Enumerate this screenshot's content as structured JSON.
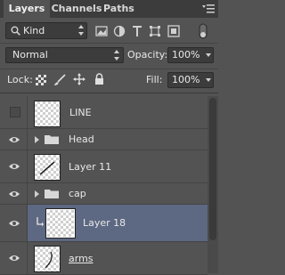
{
  "tabs": [
    {
      "label": "Layers",
      "active": true
    },
    {
      "label": "Channels",
      "active": false
    },
    {
      "label": "Paths",
      "active": false
    }
  ],
  "panel_menu_icon": "panel-menu-icon",
  "filter": {
    "kind_label": "Kind",
    "icons": [
      "pixel-filter-icon",
      "adjustment-filter-icon",
      "type-filter-icon",
      "shape-filter-icon",
      "smart-object-filter-icon",
      "filter-toggle-icon"
    ]
  },
  "blend": {
    "mode_label": "Normal",
    "opacity_label": "Opacity:",
    "opacity_value": "100%"
  },
  "lock": {
    "label": "Lock:",
    "icons": [
      "lock-transparent-icon",
      "lock-image-icon",
      "lock-position-icon",
      "lock-all-icon"
    ],
    "fill_label": "Fill:",
    "fill_value": "100%"
  },
  "layers": [
    {
      "name": "LINE",
      "type": "layer",
      "visible": false,
      "selected": false
    },
    {
      "name": "Head",
      "type": "group",
      "visible": true,
      "selected": false
    },
    {
      "name": "Layer 11",
      "type": "layer",
      "visible": true,
      "selected": false
    },
    {
      "name": "cap",
      "type": "group",
      "visible": true,
      "selected": false
    },
    {
      "name": "Layer 18",
      "type": "layer",
      "visible": true,
      "selected": true,
      "clipped": true
    },
    {
      "name": "arms",
      "type": "layer",
      "visible": true,
      "selected": false
    }
  ],
  "colors": {
    "panel_bg": "#535353",
    "selected_row": "#5d6882",
    "control_bg": "#3c3c3c"
  }
}
